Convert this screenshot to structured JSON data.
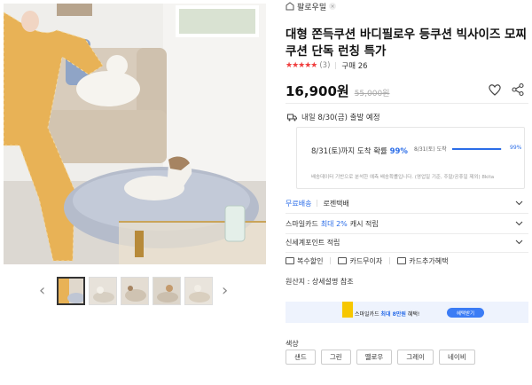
{
  "store": {
    "name": "팔로우밀"
  },
  "product": {
    "title": "대형 쫀득쿠션 바디필로우 등쿠션 빅사이즈 모찌쿠션 단독 런칭 특가",
    "stars": "★★★★★",
    "review_count": "(3)",
    "purchase": "구매 26",
    "price": "16,900원",
    "original_price": "55,000원"
  },
  "shipping": {
    "expected": "내일 8/30(금) 출발 예정",
    "arrival_label": "8/31(토)까지 도착 확률",
    "arrival_percent": "99%",
    "mini_label": "8/31(토) 도착",
    "mini_percent": "99%",
    "bar_fraction": 0.99,
    "note": "배송데이터 기반으로 분석한 예측 배송확률입니다. (영업일 기준, 주말/공휴일 제외) 8kita"
  },
  "options": {
    "free_shipping": "무료배송",
    "logen": "로젠택배",
    "smile_card_prefix": "스마일카드",
    "smile_card_highlight": "최대 2%",
    "smile_card_suffix": "캐시 적립",
    "shinsegae": "신세계포인트 적립"
  },
  "payment": {
    "items": [
      "복수할인",
      "카드무이자",
      "카드추가혜택"
    ]
  },
  "origin": "원산지 : 상세설명 참조",
  "banner": {
    "prefix": "스마일카드",
    "highlight": "최대 8만원",
    "suffix": "혜택!",
    "button": "혜택받기"
  },
  "color": {
    "label": "색상",
    "chips": [
      "샌드",
      "그린",
      "옐로우",
      "그레이",
      "네이비"
    ]
  },
  "colors": {
    "accent": "#2b6de8",
    "star": "#f03e3e",
    "card_yellow": "#f7c700"
  },
  "icons": [
    "store-icon",
    "heart-icon",
    "share-icon",
    "truck-icon",
    "chevron-down-icon",
    "chevron-left-icon",
    "chevron-right-icon"
  ]
}
